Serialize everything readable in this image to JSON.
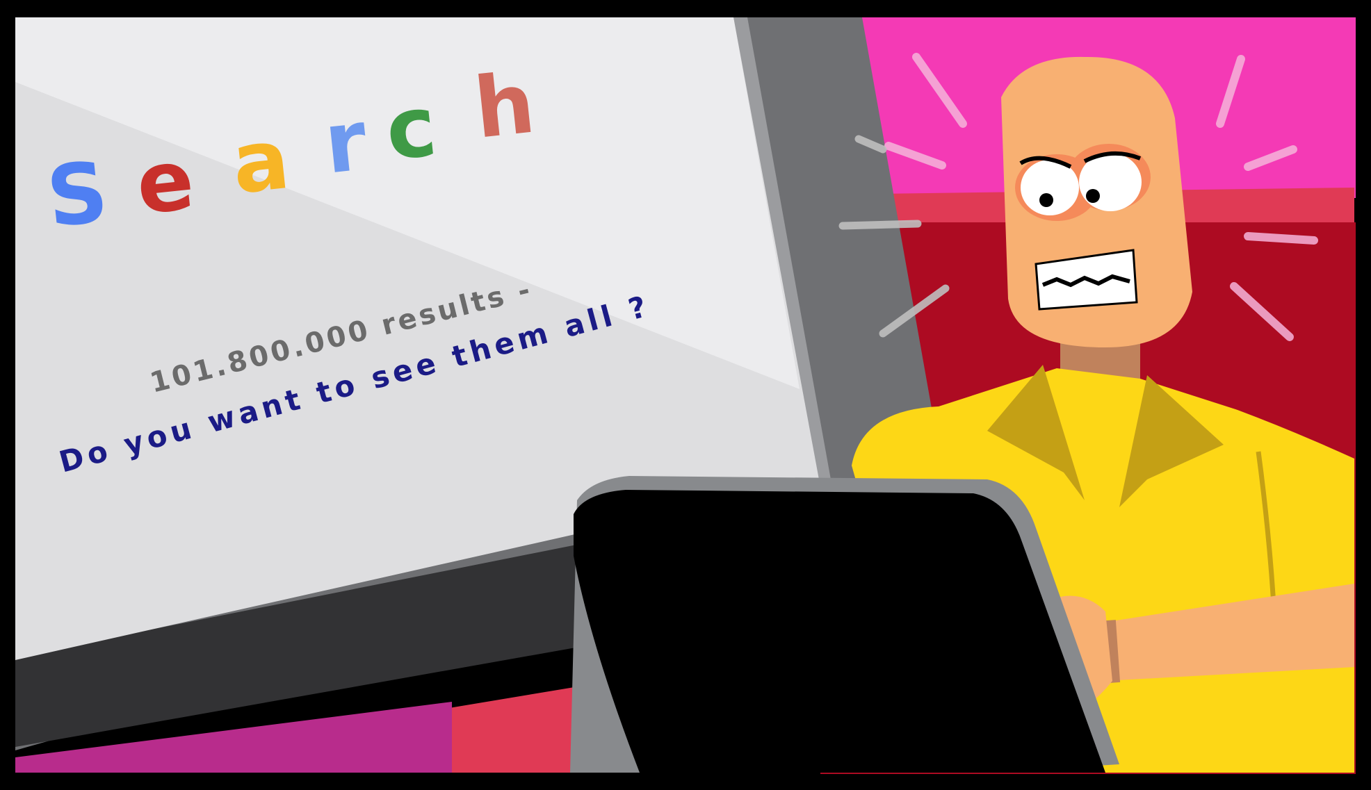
{
  "screen": {
    "search_letters": [
      {
        "char": "S",
        "color": "#4f7ff2"
      },
      {
        "char": "e",
        "color": "#c8302b"
      },
      {
        "char": "a",
        "color": "#f7b526"
      },
      {
        "char": "r",
        "color": "#6f9aef"
      },
      {
        "char": "c",
        "color": "#3f9a46"
      },
      {
        "char": "h",
        "color": "#d0695c"
      }
    ],
    "results_text": "101.800.000 results -",
    "question_text": "Do you want to see them all ?"
  },
  "colors": {
    "border": "#000000",
    "screen_light": "#ececee",
    "screen_shade": "#dedee0",
    "monitor_frame": "#6f7073",
    "monitor_edge": "#9b9c9f",
    "monitor_base": "#323234",
    "wall_pink": "#f43ab5",
    "wall_red": "#ad0b22",
    "floor_red": "#e03a55",
    "shirt": "#fdd716",
    "skin": "#f8b072",
    "tablet": "#000000",
    "results_color": "#6b6b6b",
    "question_color": "#1b1b86"
  }
}
